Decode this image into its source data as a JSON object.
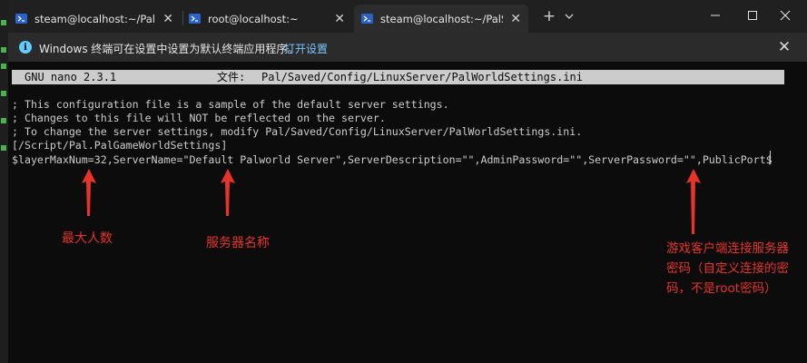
{
  "tabs": [
    {
      "title": "steam@localhost:~/PalServer",
      "active": false
    },
    {
      "title": "root@localhost:~",
      "active": false
    },
    {
      "title": "steam@localhost:~/PalServer",
      "active": true
    }
  ],
  "tab_close_glyph": "✕",
  "new_tab_glyph": "+",
  "infobar": {
    "message": "Windows 终端可在设置中设置为默认终端应用程序。",
    "link": "打开设置",
    "close_glyph": "✕"
  },
  "nano": {
    "version": "GNU nano 2.3.1",
    "file_label": "文件:",
    "file_path": "Pal/Saved/Config/LinuxServer/PalWorldSettings.ini"
  },
  "terminal_lines": [
    "; This configuration file is a sample of the default server settings.",
    "; Changes to this file will NOT be reflected on the server.",
    "; To change the server settings, modify Pal/Saved/Config/LinuxServer/PalWorldSettings.ini.",
    "[/Script/Pal.PalGameWorldSettings]",
    "$layerMaxNum=32,ServerName=\"Default Palworld Server\",ServerDescription=\"\",AdminPassword=\"\",ServerPassword=\"\",PublicPort$"
  ],
  "annotations": {
    "max_players": "最大人数",
    "server_name": "服务器名称",
    "server_password": [
      "游戏客户端连接服务器",
      "密码（自定义连接的密",
      "码，不是root密码）"
    ]
  },
  "colors": {
    "annotation": "#e8332b",
    "link": "#78c8ff",
    "info_icon": "#60cdff",
    "terminal_bg": "#0c0c0c",
    "terminal_fg": "#cccccc"
  }
}
